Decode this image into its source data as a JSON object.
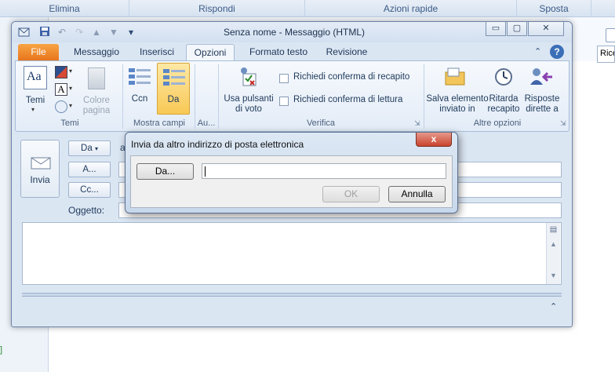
{
  "background": {
    "ribbon_groups": [
      "Elimina",
      "Rispondi",
      "Azioni rapide",
      "Sposta"
    ],
    "search_partial": "Rice"
  },
  "window": {
    "title": "Senza nome  -  Messaggio (HTML)",
    "controls": {
      "minimize": "▭",
      "maximize": "▢",
      "close": "✕"
    },
    "help": "?"
  },
  "tabs": [
    {
      "label": "File"
    },
    {
      "label": "Messaggio"
    },
    {
      "label": "Inserisci"
    },
    {
      "label": "Opzioni"
    },
    {
      "label": "Formato testo"
    },
    {
      "label": "Revisione"
    }
  ],
  "ribbon": {
    "temi": {
      "button": "Temi",
      "colore_pagina": "Colore pagina",
      "group": "Temi"
    },
    "mostra_campi": {
      "ccn": "Ccn",
      "da": "Da",
      "group": "Mostra campi"
    },
    "au_group": "Au...",
    "verifica": {
      "voting": "Usa pulsanti di voto",
      "check_delivery": "Richiedi conferma di recapito",
      "check_read": "Richiedi conferma di lettura",
      "group": "Verifica"
    },
    "altre_opzioni": {
      "save_sent": "Salva elemento inviato in",
      "delay": "Ritarda recapito",
      "direct_replies": "Risposte dirette a",
      "group": "Altre opzioni"
    }
  },
  "compose": {
    "send": "Invia",
    "from_btn": "Da",
    "to_btn": "A...",
    "cc_btn": "Cc...",
    "subject_label": "Oggetto:",
    "a_partial": "a"
  },
  "dialog": {
    "title": "Invia da altro indirizzo di posta elettronica",
    "from_btn": "Da...",
    "from_value": "",
    "ok": "OK",
    "cancel": "Annulla",
    "close": "x"
  }
}
